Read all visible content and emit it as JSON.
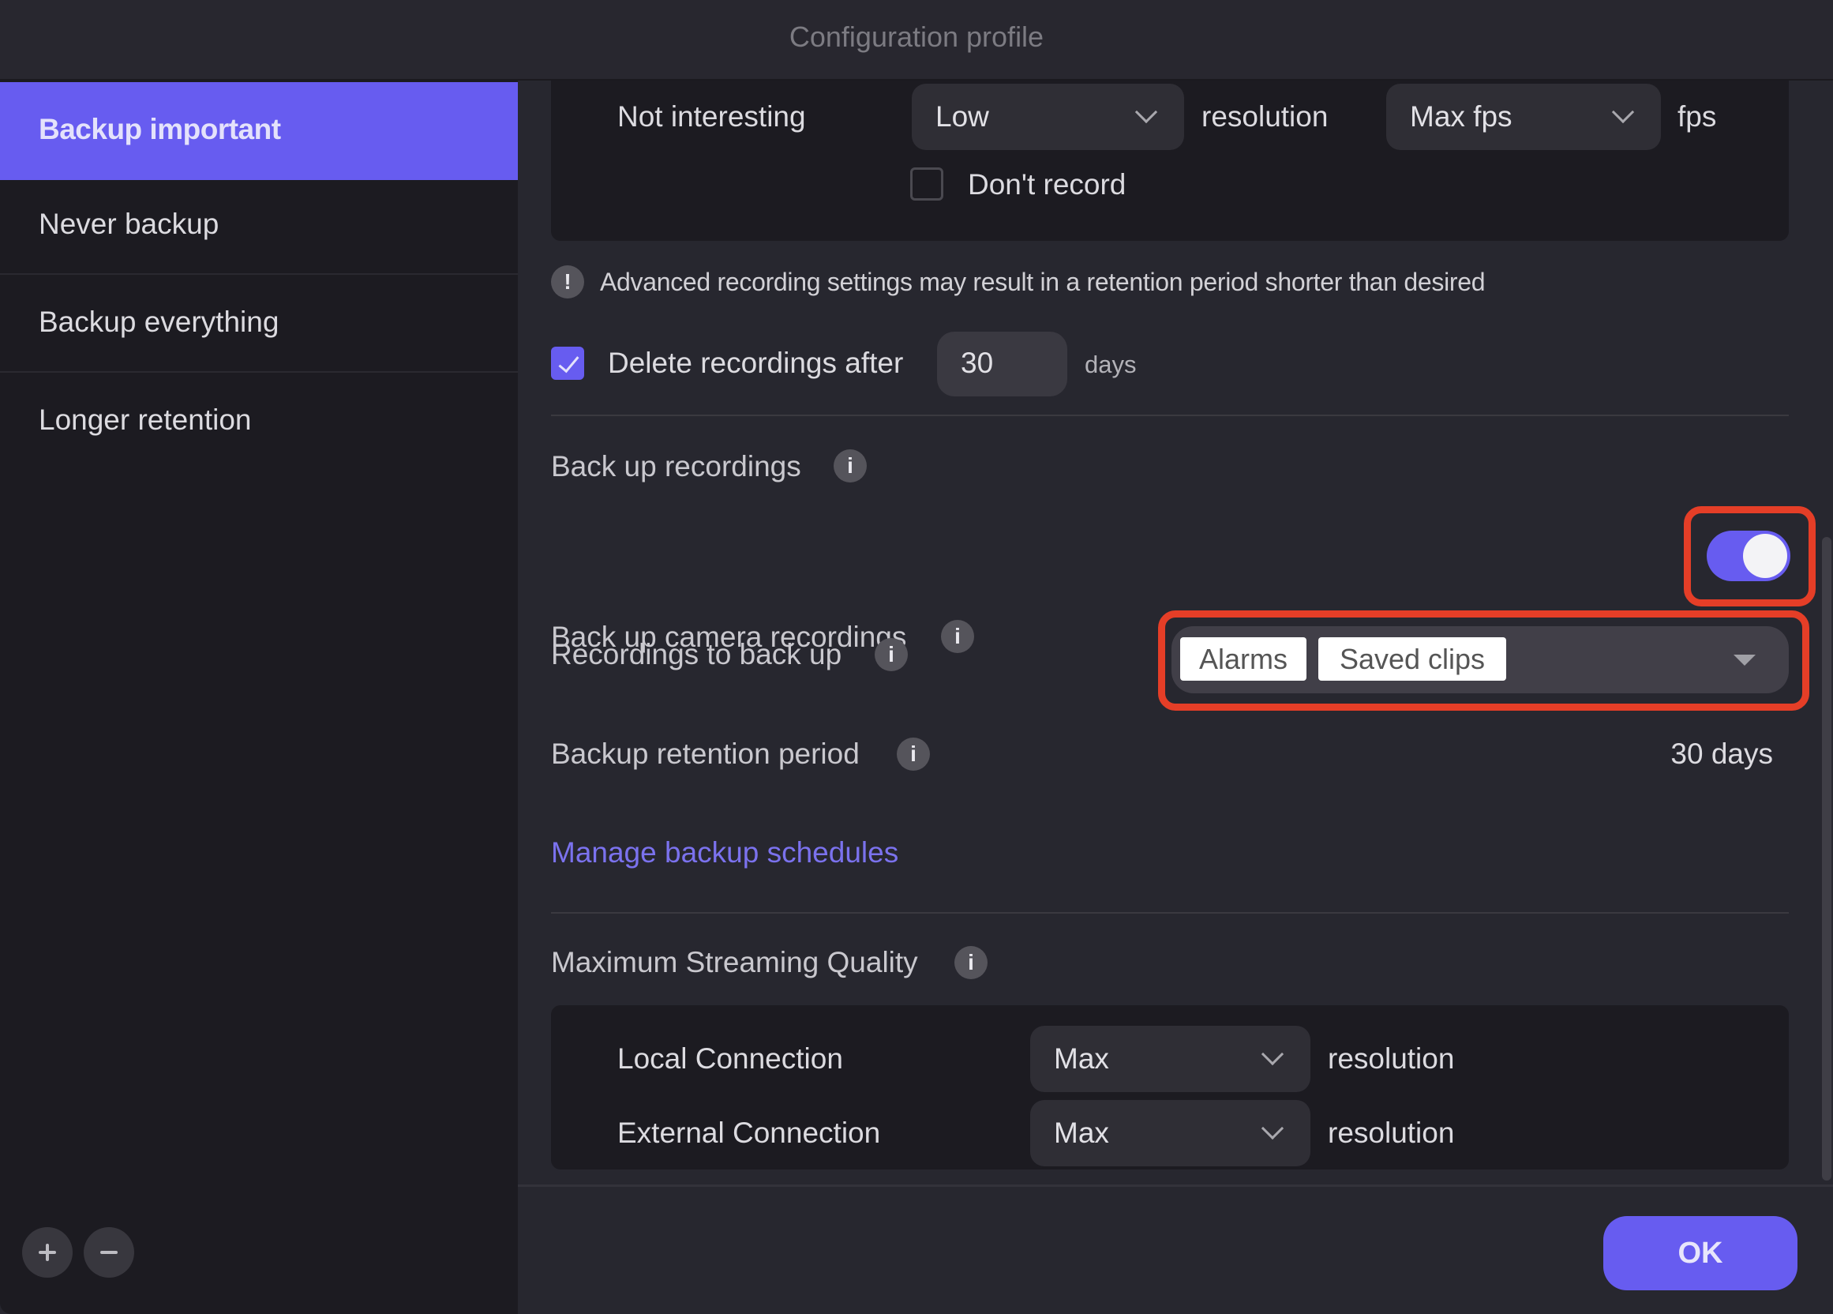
{
  "window": {
    "title": "Configuration profile"
  },
  "sidebar": {
    "items": [
      {
        "label": "Backup important",
        "selected": true
      },
      {
        "label": "Never backup",
        "selected": false
      },
      {
        "label": "Backup everything",
        "selected": false
      },
      {
        "label": "Longer retention",
        "selected": false
      }
    ],
    "add_icon": "plus-icon",
    "remove_icon": "minus-icon"
  },
  "recording_quality": {
    "row_label": "Not interesting",
    "resolution_value": "Low",
    "resolution_unit": "resolution",
    "fps_value": "Max fps",
    "fps_unit": "fps",
    "dont_record_label": "Don't record",
    "dont_record_checked": false
  },
  "warning": {
    "icon": "exclamation-icon",
    "text": "Advanced recording settings may result in a retention period shorter than desired"
  },
  "delete_recordings": {
    "label": "Delete recordings after",
    "checked": true,
    "value": "30",
    "unit": "days"
  },
  "backup": {
    "section_title": "Back up recordings",
    "camera_label": "Back up camera recordings",
    "camera_enabled": true,
    "recordings_label": "Recordings to back up",
    "selected_tags": [
      "Alarms",
      "Saved clips"
    ],
    "retention_label": "Backup retention period",
    "retention_value": "30 days",
    "manage_link": "Manage backup schedules"
  },
  "streaming": {
    "section_title": "Maximum Streaming Quality",
    "rows": [
      {
        "label": "Local Connection",
        "value": "Max",
        "unit": "resolution"
      },
      {
        "label": "External Connection",
        "value": "Max",
        "unit": "resolution"
      }
    ]
  },
  "footer": {
    "ok_label": "OK"
  },
  "colors": {
    "accent": "#675cf0",
    "highlight_annotation": "#e53e27",
    "background": "#27272f",
    "sidebar_background": "#1c1b21"
  }
}
